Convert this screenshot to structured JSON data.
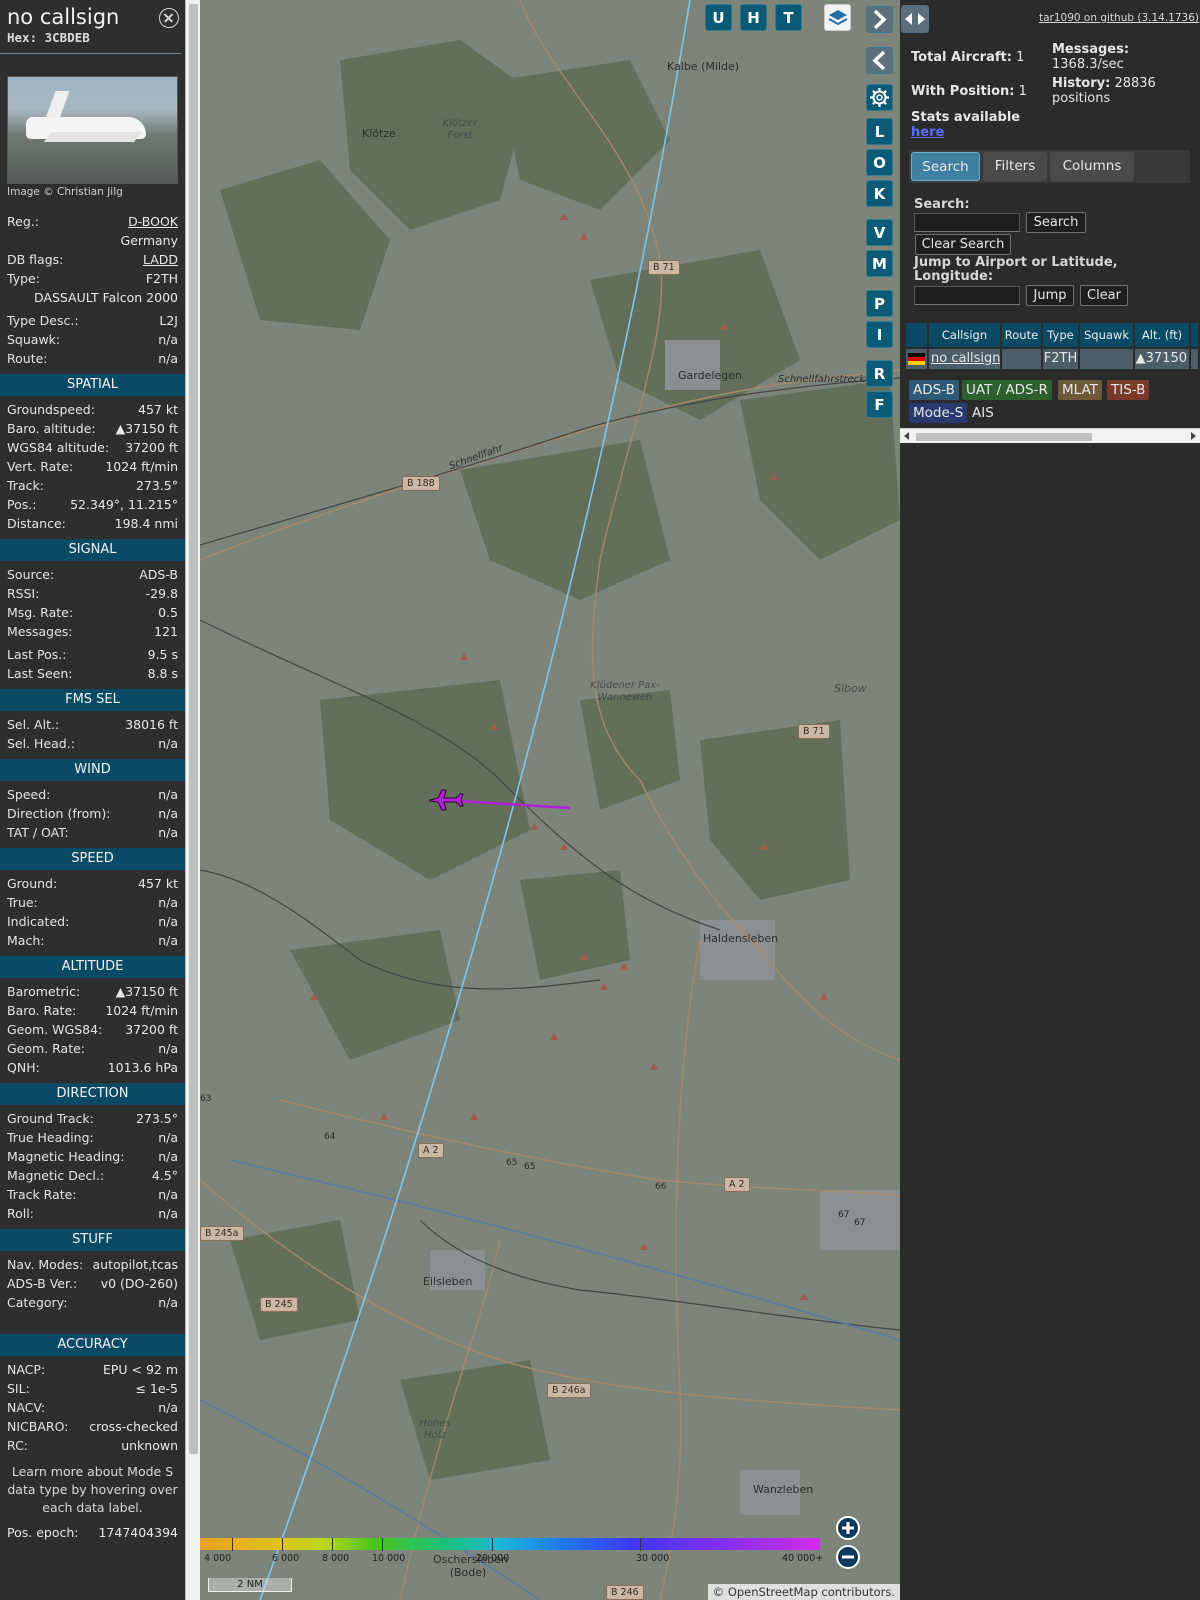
{
  "info": {
    "callsign": "no callsign",
    "hex": "Hex: 3CBDEB",
    "image_credit": "Image © Christian Jilg",
    "basic": [
      {
        "label": "Reg.:",
        "value": "D-BOOK",
        "link": true
      },
      {
        "label": "",
        "value": "Germany"
      },
      {
        "label": "DB flags:",
        "value": "LADD",
        "link": true
      },
      {
        "label": "Type:",
        "value": "F2TH"
      },
      {
        "label": "",
        "value": "DASSAULT Falcon 2000"
      },
      {
        "label": "Type Desc.:",
        "value": "L2J"
      },
      {
        "label": "Squawk:",
        "value": "n/a"
      },
      {
        "label": "Route:",
        "value": "n/a"
      }
    ],
    "sections": [
      {
        "title": "SPATIAL",
        "rows": [
          {
            "label": "Groundspeed:",
            "value": "457 kt"
          },
          {
            "label": "Baro. altitude:",
            "value": "▲37150 ft"
          },
          {
            "label": "WGS84 altitude:",
            "value": "37200 ft"
          },
          {
            "label": "Vert. Rate:",
            "value": "1024 ft/min"
          },
          {
            "label": "Track:",
            "value": "273.5°"
          },
          {
            "label": "Pos.:",
            "value": "52.349°, 11.215°"
          },
          {
            "label": "Distance:",
            "value": "198.4 nmi"
          }
        ]
      },
      {
        "title": "SIGNAL",
        "rows": [
          {
            "label": "Source:",
            "value": "ADS-B"
          },
          {
            "label": "RSSI:",
            "value": "-29.8"
          },
          {
            "label": "Msg. Rate:",
            "value": "0.5"
          },
          {
            "label": "Messages:",
            "value": "121"
          },
          {
            "label": "Last Pos.:",
            "value": "9.5 s"
          },
          {
            "label": "Last Seen:",
            "value": "8.8 s"
          }
        ]
      },
      {
        "title": "FMS SEL",
        "rows": [
          {
            "label": "Sel. Alt.:",
            "value": "38016 ft"
          },
          {
            "label": "Sel. Head.:",
            "value": "n/a"
          }
        ]
      },
      {
        "title": "WIND",
        "rows": [
          {
            "label": "Speed:",
            "value": "n/a"
          },
          {
            "label": "Direction (from):",
            "value": "n/a"
          },
          {
            "label": "TAT / OAT:",
            "value": "n/a"
          }
        ]
      },
      {
        "title": "SPEED",
        "rows": [
          {
            "label": "Ground:",
            "value": "457 kt"
          },
          {
            "label": "True:",
            "value": "n/a"
          },
          {
            "label": "Indicated:",
            "value": "n/a"
          },
          {
            "label": "Mach:",
            "value": "n/a"
          }
        ]
      },
      {
        "title": "ALTITUDE",
        "rows": [
          {
            "label": "Barometric:",
            "value": "▲37150 ft"
          },
          {
            "label": "Baro. Rate:",
            "value": "1024 ft/min"
          },
          {
            "label": "Geom. WGS84:",
            "value": "37200 ft"
          },
          {
            "label": "Geom. Rate:",
            "value": "n/a"
          },
          {
            "label": "QNH:",
            "value": "1013.6 hPa"
          }
        ]
      },
      {
        "title": "DIRECTION",
        "rows": [
          {
            "label": "Ground Track:",
            "value": "273.5°"
          },
          {
            "label": "True Heading:",
            "value": "n/a"
          },
          {
            "label": "Magnetic Heading:",
            "value": "n/a"
          },
          {
            "label": "Magnetic Decl.:",
            "value": "4.5°"
          },
          {
            "label": "Track Rate:",
            "value": "n/a"
          },
          {
            "label": "Roll:",
            "value": "n/a"
          }
        ]
      },
      {
        "title": "STUFF",
        "rows": [
          {
            "label": "Nav. Modes:",
            "value": "autopilot,tcas"
          },
          {
            "label": "ADS-B Ver.:",
            "value": "v0 (DO-260)"
          },
          {
            "label": "Category:",
            "value": "n/a"
          }
        ]
      },
      {
        "title": "ACCURACY",
        "rows": [
          {
            "label": "NACP:",
            "value": "EPU < 92 m"
          },
          {
            "label": "SIL:",
            "value": "≤ 1e-5"
          },
          {
            "label": "NACV:",
            "value": "n/a"
          },
          {
            "label": "NICBARO:",
            "value": "cross-checked"
          },
          {
            "label": "RC:",
            "value": "unknown"
          }
        ]
      }
    ],
    "note": "Learn more about Mode S data type by hovering over each data label.",
    "epoch_label": "Pos. epoch:",
    "epoch_value": "1747404394"
  },
  "map": {
    "buttons_top": [
      "U",
      "H",
      "T"
    ],
    "buttons_side": [
      "L",
      "O",
      "K",
      "V",
      "M",
      "P",
      "I",
      "R",
      "F"
    ],
    "places": [
      "Kalbe (Milde)",
      "Klötze",
      "Gardelegen",
      "Haldensleben",
      "Eilsleben",
      "Wanzleben",
      "Oschersleben (Bode)",
      "Sibow"
    ],
    "forests": [
      "Klötzer Forst",
      "Klüdener Pax-Wanneweh",
      "Hohes Holz"
    ],
    "roads": [
      "B 71",
      "B 188",
      "B 71",
      "A 2",
      "A 2",
      "B 245a",
      "B 245",
      "B 246a",
      "B 246"
    ],
    "road_texts": [
      "Schnellfahrstrecke",
      "Schnellfahr",
      "63",
      "64",
      "65",
      "65",
      "66",
      "67",
      "67"
    ],
    "altitude_scale": [
      "4 000",
      "6 000",
      "8 000",
      "10 000",
      "20 000",
      "30 000",
      "40 000+"
    ],
    "scale_label": "2 NM",
    "attribution": "© OpenStreetMap contributors.",
    "colors": {
      "aircraft": "#b51fd6",
      "altitude_bar_end": "#d02df0",
      "button": "#0b5a76"
    }
  },
  "side": {
    "github_link": "tar1090 on github (3.14.1736)",
    "total_label": "Total Aircraft:",
    "total_value": "1",
    "with_pos_label": "With Position:",
    "with_pos_value": "1",
    "stats_label": "Stats available",
    "stats_link": "here",
    "messages_label": "Messages:",
    "messages_value": "1368.3/sec",
    "history_label": "History:",
    "history_value": "28836 positions",
    "tabs": [
      "Search",
      "Filters",
      "Columns"
    ],
    "search_label": "Search:",
    "search_button": "Search",
    "clear_search_button": "Clear Search",
    "jump_label": "Jump to Airport or Latitude, Longitude:",
    "jump_button": "Jump",
    "clear_button": "Clear",
    "table": {
      "headers": [
        "",
        "Callsign",
        "Route",
        "Type",
        "Squawk",
        "Alt. (ft)"
      ],
      "row": {
        "callsign": "no callsign",
        "route": "",
        "type": "F2TH",
        "squawk": "",
        "alt": "▲37150"
      }
    },
    "sources": [
      {
        "label": "ADS-B",
        "bg": "#2e5a76",
        "fg": "#e6e6e6"
      },
      {
        "label": "UAT / ADS-R",
        "bg": "#2e5f2e",
        "fg": "#e6e6e6"
      },
      {
        "label": "MLAT",
        "bg": "#6e5a3a",
        "fg": "#e6e6e6"
      },
      {
        "label": "TIS-B",
        "bg": "#7a3a2a",
        "fg": "#e6e6e6"
      },
      {
        "label": "Mode-S",
        "bg": "#2a3a6e",
        "fg": "#e6e6e6"
      },
      {
        "label": "AIS",
        "bg": "#2b2b2b",
        "fg": "#e6e6e6"
      }
    ]
  }
}
